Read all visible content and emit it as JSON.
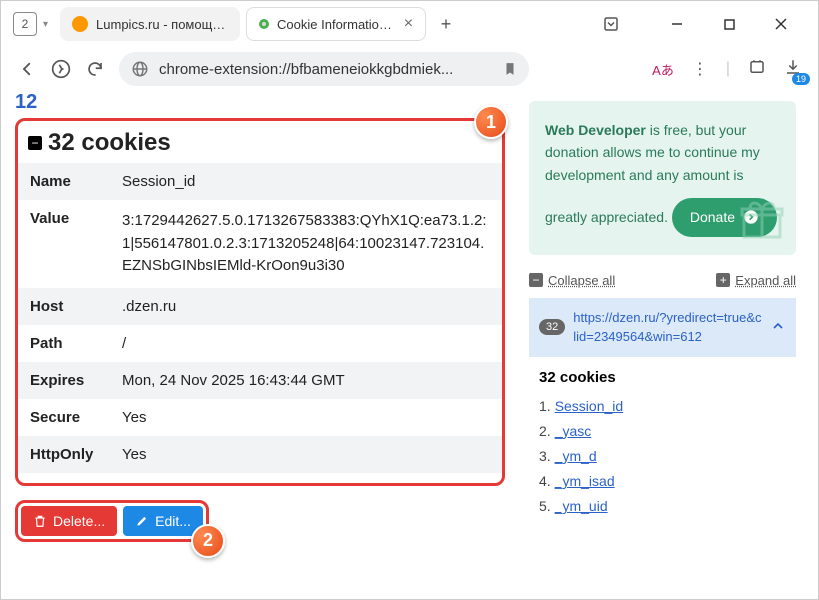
{
  "titlebar": {
    "tab_count": "2",
    "tabs": [
      {
        "title": "Lumpics.ru - помощь с ком",
        "favicon_color": "#ff9800",
        "active": false
      },
      {
        "title": "Cookie Information from",
        "favicon_color": "#4caf50",
        "active": true
      }
    ]
  },
  "addressbar": {
    "url": "chrome-extension://bfbameneiokkgbdmiek...",
    "translate_label": "Aあ",
    "notifications_count": "19"
  },
  "headerNumber": "12",
  "cookiePanel": {
    "title": "32 cookies",
    "rows": {
      "name_label": "Name",
      "name_value": "Session_id",
      "value_label": "Value",
      "value_value": "3:1729442627.5.0.1713267583383:QYhX1Q:ea73.1.2:1|556147801.0.2.3:1713205248|64:10023147.723104.EZNSbGINbsIEMld-KrOon9u3i30",
      "host_label": "Host",
      "host_value": ".dzen.ru",
      "path_label": "Path",
      "path_value": "/",
      "expires_label": "Expires",
      "expires_value": "Mon, 24 Nov 2025 16:43:44 GMT",
      "secure_label": "Secure",
      "secure_value": "Yes",
      "httponly_label": "HttpOnly",
      "httponly_value": "Yes"
    }
  },
  "actions": {
    "delete_label": "Delete...",
    "edit_label": "Edit..."
  },
  "donate": {
    "text_bold": "Web Developer",
    "text_rest": " is free, but your donation allows me to continue my development and any amount is greatly appreciated.",
    "button_label": "Donate"
  },
  "sideControls": {
    "collapse_label": "Collapse all",
    "expand_label": "Expand all"
  },
  "urlPanel": {
    "count": "32",
    "url": "https://dzen.ru/?yredirect=true&clid=2349564&win=612"
  },
  "cookieList": {
    "title": "32 cookies",
    "items": [
      {
        "num": "1.",
        "name": "Session_id"
      },
      {
        "num": "2.",
        "name": "_yasc"
      },
      {
        "num": "3.",
        "name": "_ym_d"
      },
      {
        "num": "4.",
        "name": "_ym_isad"
      },
      {
        "num": "5.",
        "name": "_ym_uid"
      }
    ]
  },
  "callouts": {
    "one": "1",
    "two": "2"
  }
}
